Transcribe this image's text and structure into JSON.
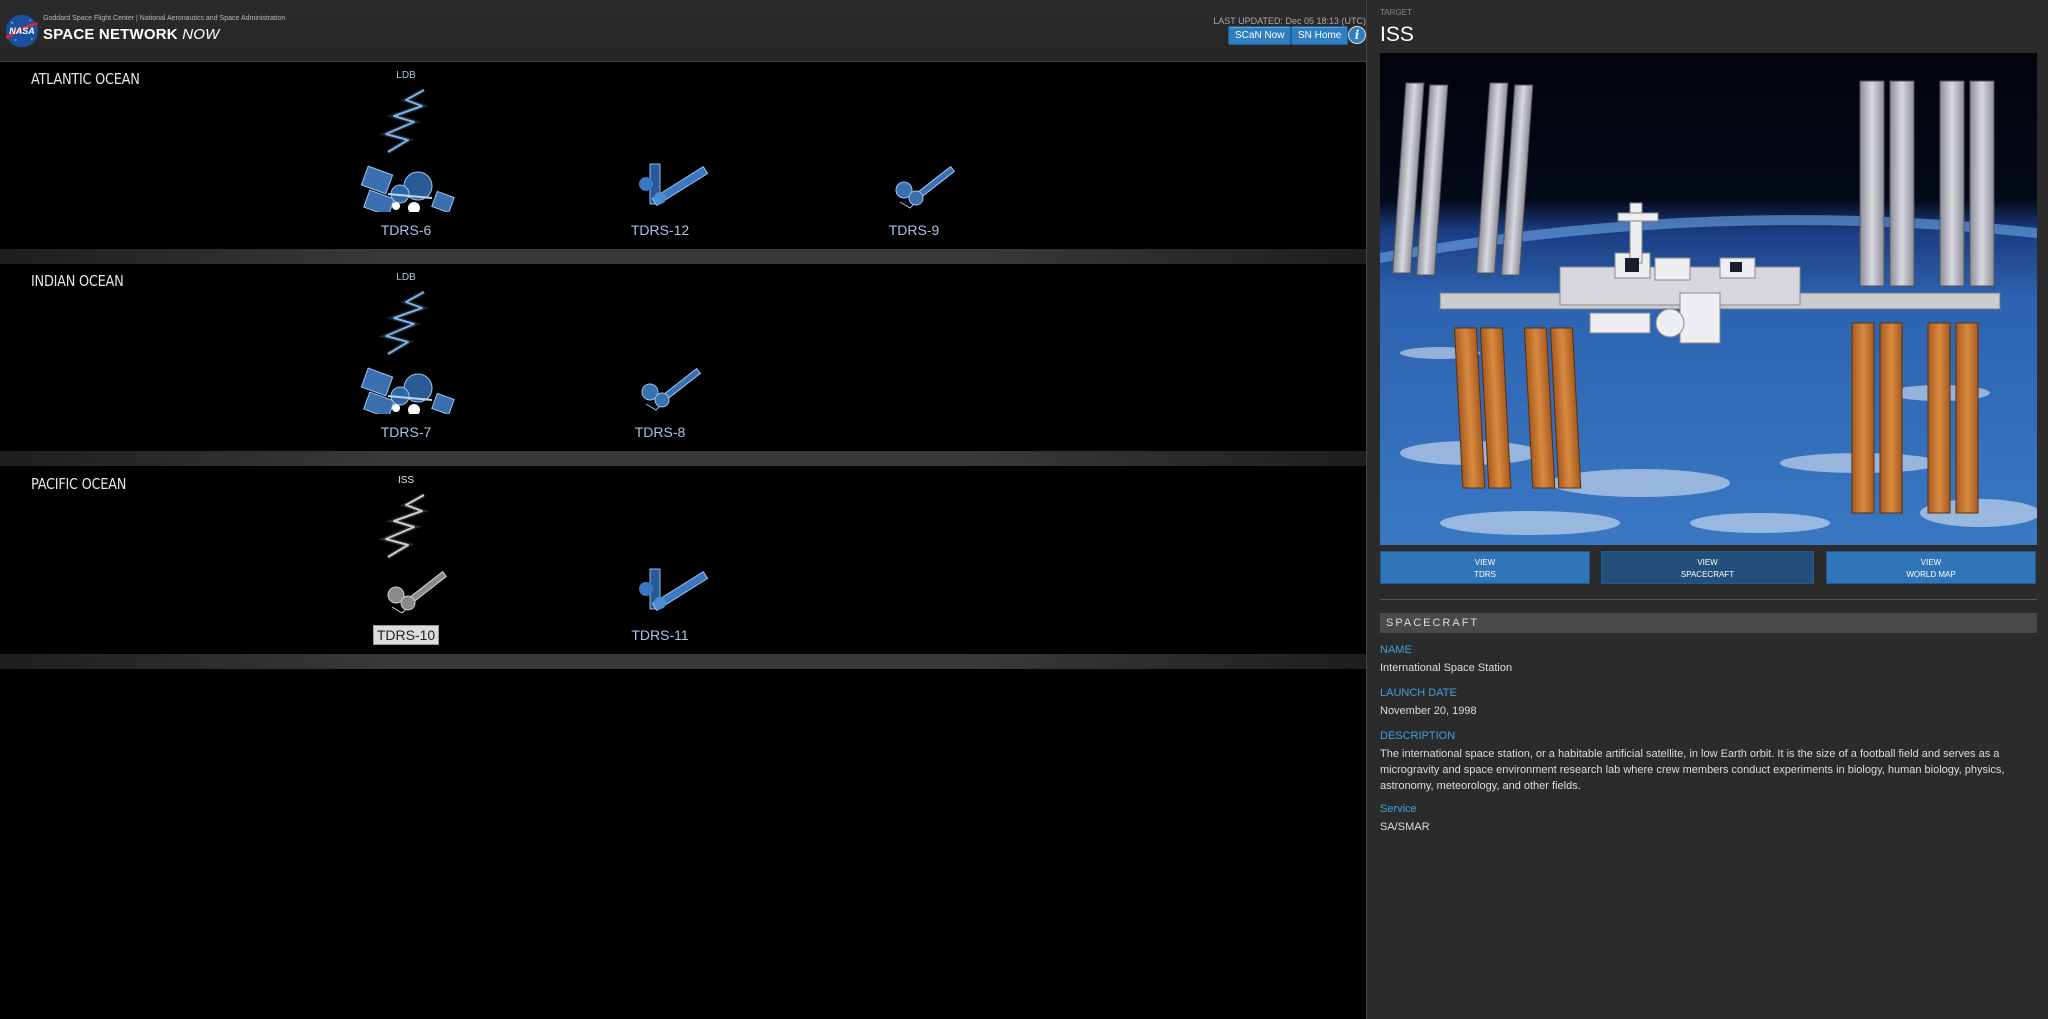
{
  "header": {
    "org_line": "Goddard Space Flight Center | National Aeronautics and Space Administration",
    "title_main": "SPACE NETWORK ",
    "title_now": "NOW",
    "last_updated": "LAST UPDATED: Dec 05 18:13 (UTC)",
    "scan_now_label": "SCaN Now",
    "sn_home_label": "SN Home",
    "info_label": "i",
    "logo_text": "NASA"
  },
  "oceans": [
    {
      "name": "ATLANTIC OCEAN",
      "satellites": [
        {
          "name": "TDRS-6",
          "tag": "LDB",
          "art": "satellite-tdrs1-active"
        },
        {
          "name": "TDRS-12",
          "tag": "",
          "art": "satellite-tdrs3"
        },
        {
          "name": "TDRS-9",
          "tag": "",
          "art": "satellite-tdrs2"
        }
      ]
    },
    {
      "name": "INDIAN OCEAN",
      "satellites": [
        {
          "name": "TDRS-7",
          "tag": "LDB",
          "art": "satellite-tdrs1-active"
        },
        {
          "name": "TDRS-8",
          "tag": "",
          "art": "satellite-tdrs2"
        }
      ]
    },
    {
      "name": "PACIFIC OCEAN",
      "satellites": [
        {
          "name": "TDRS-10",
          "tag": "ISS",
          "art": "satellite-tdrs2-active",
          "selected": true
        },
        {
          "name": "TDRS-11",
          "tag": "",
          "art": "satellite-tdrs3"
        }
      ]
    }
  ],
  "panel": {
    "target_label": "TARGET",
    "target_name": "ISS",
    "view_tdrs": [
      "VIEW",
      "TDRS"
    ],
    "view_spacecraft": [
      "VIEW",
      "SPACECRAFT"
    ],
    "view_worldmap": [
      "VIEW",
      "WORLD MAP"
    ],
    "section_title": "SPACECRAFT",
    "fields": {
      "name_label": "NAME",
      "name_value": "International Space Station",
      "launch_label": "LAUNCH DATE",
      "launch_value": "November 20, 1998",
      "desc_label": "DESCRIPTION",
      "desc_value": "The international space station, or a habitable artificial satellite, in low Earth orbit. It is the size of a football field and serves as a microgravity and space environment research lab where crew members conduct experiments in biology, human biology, physics, astronomy, meteorology, and other fields.",
      "service_label": "Service",
      "service_value": "SA/SMAR"
    }
  },
  "colors": {
    "accent_blue": "#2f7fc0",
    "field_label_blue": "#3fa0e0",
    "sat_name": "#a9c4e6",
    "link_beam": "#7fb2e8"
  }
}
